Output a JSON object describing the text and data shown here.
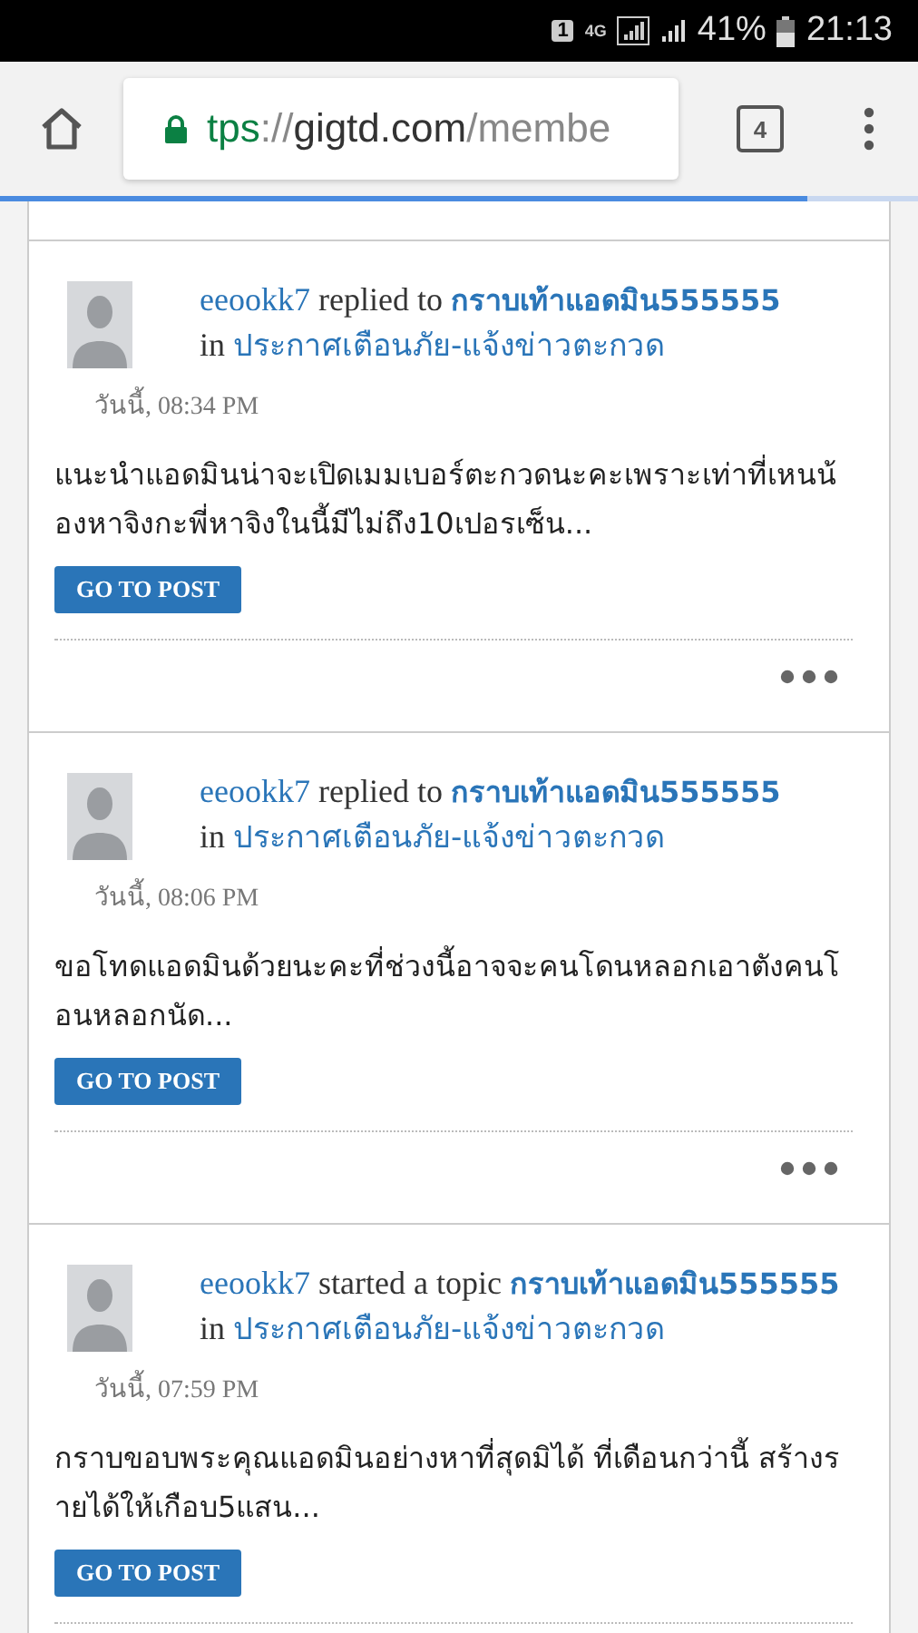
{
  "status_bar": {
    "sim": "1",
    "network": "4G",
    "battery": "41%",
    "time": "21:13"
  },
  "browser": {
    "url": {
      "scheme": "tps",
      "separator": "://",
      "domain": "gigtd.com",
      "path": "/membe"
    },
    "secure": true,
    "tab_count": "4",
    "load_progress": {
      "level": 0.88
    }
  },
  "posts": [
    {
      "user": "eeookk7",
      "action": "replied to",
      "topic": "กราบเท้าแอดมิน555555",
      "in": "in",
      "forum": "ประกาศเตือนภัย-แจ้งข่าวตะกวด",
      "time": "วันนี้, 08:34 PM",
      "excerpt": "แนะนำแอดมินน่าจะเปิดเมมเบอร์ตะกวดนะคะเพราะเท่าที่เหนน้องหาจิงกะพี่หาจิงในนี้มีไม่ถึง10เปอรเซ็น...",
      "button": "GO TO POST",
      "more_menu": true
    },
    {
      "user": "eeookk7",
      "action": "replied to",
      "topic": "กราบเท้าแอดมิน555555",
      "in": "in",
      "forum": "ประกาศเตือนภัย-แจ้งข่าวตะกวด",
      "time": "วันนี้, 08:06 PM",
      "excerpt": "ขอโทดแอดมินด้วยนะคะที่ช่วงนี้อาจจะคนโดนหลอกเอาตังคนโอนหลอกนัด...",
      "button": "GO TO POST",
      "more_menu": true
    },
    {
      "user": "eeookk7",
      "action": "started a topic",
      "topic": "กราบเท้าแอดมิน555555",
      "in": "in",
      "forum": "ประกาศเตือนภัย-แจ้งข่าวตะกวด",
      "time": "วันนี้, 07:59 PM",
      "excerpt": "กราบขอบพระคุณแอดมินอย่างหาที่สุดมิได้ ที่เดือนกว่านี้ สร้างรายได้ให้เกือบ5แสน...",
      "button": "GO TO POST"
    }
  ]
}
